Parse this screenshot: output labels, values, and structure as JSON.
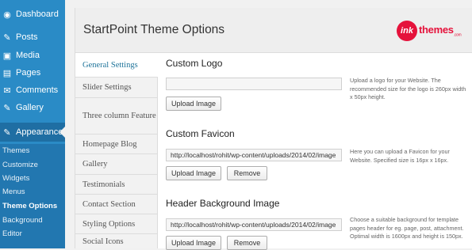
{
  "admin_menu": {
    "items": [
      {
        "label": "Dashboard",
        "icon": "dashboard-icon",
        "glyph": "◉"
      },
      {
        "label": "Posts",
        "icon": "pin-icon",
        "glyph": "✎"
      },
      {
        "label": "Media",
        "icon": "media-icon",
        "glyph": "▣"
      },
      {
        "label": "Pages",
        "icon": "pages-icon",
        "glyph": "▤"
      },
      {
        "label": "Comments",
        "icon": "comments-icon",
        "glyph": "✉"
      },
      {
        "label": "Gallery",
        "icon": "pin-icon",
        "glyph": "✎"
      },
      {
        "label": "Appearance",
        "icon": "appearance-icon",
        "glyph": "✎"
      }
    ],
    "submenu": [
      "Themes",
      "Customize",
      "Widgets",
      "Menus",
      "Theme Options",
      "Background",
      "Editor"
    ],
    "current_sub": "Theme Options"
  },
  "header": {
    "title": "StartPoint Theme Options",
    "logo_mark": "ink",
    "logo_text": "themes",
    "logo_suffix": ".com"
  },
  "tabs": [
    "General Settings",
    "Slider Settings",
    "Three column Feature",
    "Homepage Blog",
    "Gallery",
    "Testimonials",
    "Contact Section",
    "Styling Options",
    "Social Icons"
  ],
  "active_tab": "General Settings",
  "sections": {
    "logo": {
      "title": "Custom Logo",
      "value": "",
      "upload_label": "Upload Image",
      "help": "Upload a logo for your Website. The recommended size for the logo is 260px width x 50px height."
    },
    "favicon": {
      "title": "Custom Favicon",
      "value": "http://localhost/rohit/wp-content/uploads/2014/02/image",
      "upload_label": "Upload Image",
      "remove_label": "Remove",
      "help": "Here you can upload a Favicon for your Website. Specified size is 16px x 16px."
    },
    "header_bg": {
      "title": "Header Background Image",
      "value": "http://localhost/rohit/wp-content/uploads/2014/02/image",
      "upload_label": "Upload Image",
      "remove_label": "Remove",
      "help": "Choose a suitable background for template pages header for eg. page, post, attachment. Optimal width is 1600px and height is 150px."
    }
  }
}
